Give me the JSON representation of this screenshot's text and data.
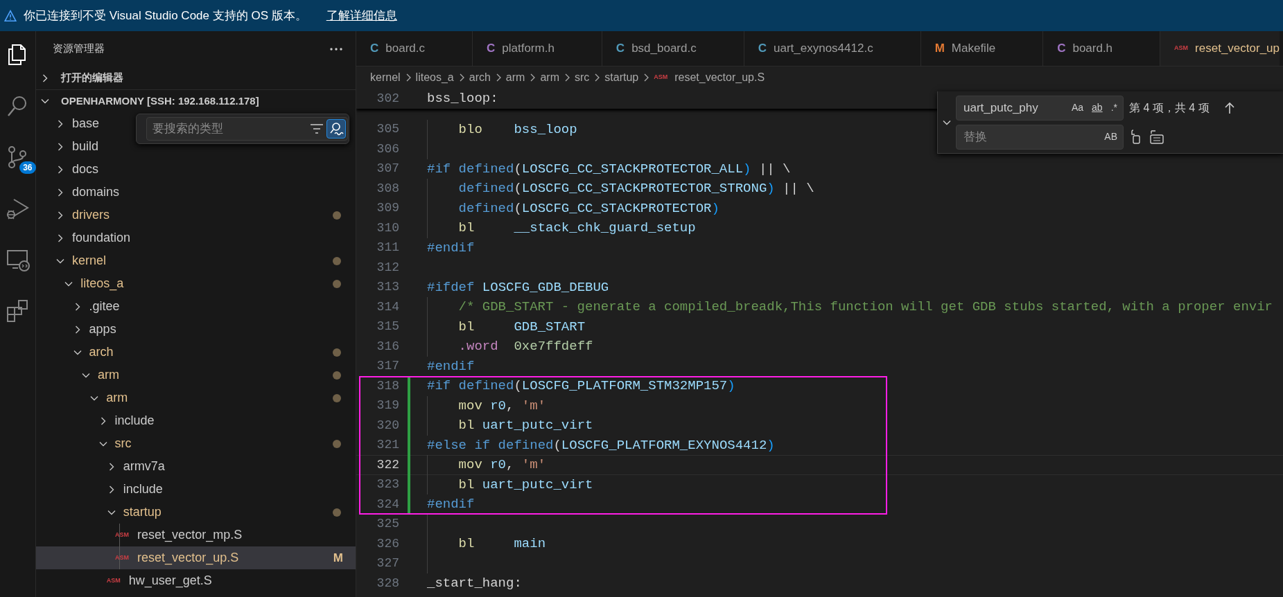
{
  "notification_bar": {
    "message": "你已连接到不受 Visual Studio Code 支持的 OS 版本。",
    "link": "了解详细信息"
  },
  "activity_bar": {
    "items": [
      {
        "kind": "explorer",
        "selected": true
      },
      {
        "kind": "search",
        "selected": false
      },
      {
        "kind": "source-control",
        "selected": false,
        "badge": "36"
      },
      {
        "kind": "run-debug",
        "selected": false
      },
      {
        "kind": "remote",
        "selected": false
      },
      {
        "kind": "extensions",
        "selected": false
      }
    ]
  },
  "sidebar": {
    "title": "资源管理器",
    "sections": [
      {
        "title": "打开的编辑器",
        "expanded": false
      },
      {
        "title": "OPENHARMONY [SSH: 192.168.112.178]",
        "expanded": true
      }
    ],
    "filter": {
      "placeholder": "要搜索的类型",
      "fuzzy_match": true
    },
    "tree": [
      {
        "label": "base",
        "kind": "folder",
        "expanded": false,
        "modified": false
      },
      {
        "label": "build",
        "kind": "folder",
        "expanded": false,
        "modified": false
      },
      {
        "label": "docs",
        "kind": "folder",
        "expanded": false,
        "modified": false
      },
      {
        "label": "domains",
        "kind": "folder",
        "expanded": false,
        "modified": false
      },
      {
        "label": "drivers",
        "kind": "folder",
        "expanded": false,
        "modified": true
      },
      {
        "label": "foundation",
        "kind": "folder",
        "expanded": false,
        "modified": false
      },
      {
        "label": "kernel",
        "kind": "folder",
        "expanded": true,
        "modified": true,
        "children": [
          {
            "label": "liteos_a",
            "kind": "folder",
            "expanded": true,
            "modified": true,
            "children": [
              {
                "label": ".gitee",
                "kind": "folder",
                "expanded": false,
                "modified": false
              },
              {
                "label": "apps",
                "kind": "folder",
                "expanded": false,
                "modified": false
              },
              {
                "label": "arch",
                "kind": "folder",
                "expanded": true,
                "modified": true,
                "children": [
                  {
                    "label": "arm",
                    "kind": "folder",
                    "expanded": true,
                    "modified": true,
                    "children": [
                      {
                        "label": "arm",
                        "kind": "folder",
                        "expanded": true,
                        "modified": true,
                        "children": [
                          {
                            "label": "include",
                            "kind": "folder",
                            "expanded": false,
                            "modified": false
                          },
                          {
                            "label": "src",
                            "kind": "folder",
                            "expanded": true,
                            "modified": true,
                            "children": [
                              {
                                "label": "armv7a",
                                "kind": "folder",
                                "expanded": false,
                                "modified": false
                              },
                              {
                                "label": "include",
                                "kind": "folder",
                                "expanded": false,
                                "modified": false
                              },
                              {
                                "label": "startup",
                                "kind": "folder",
                                "expanded": true,
                                "modified": true,
                                "children": [
                                  {
                                    "label": "reset_vector_mp.S",
                                    "kind": "file",
                                    "icon": "ASM",
                                    "modified": false,
                                    "selected": false
                                  },
                                  {
                                    "label": "reset_vector_up.S",
                                    "kind": "file",
                                    "icon": "ASM",
                                    "modified": true,
                                    "selected": true,
                                    "badge": "M"
                                  }
                                ]
                              },
                              {
                                "label": "hw_user_get.S",
                                "kind": "file",
                                "icon": "ASM",
                                "modified": false,
                                "selected": false
                              }
                            ]
                          }
                        ]
                      }
                    ]
                  }
                ]
              }
            ]
          }
        ]
      }
    ]
  },
  "tabs": [
    {
      "label": "board.c",
      "icon": "C",
      "color": "#519aba",
      "selected": false,
      "modified": false
    },
    {
      "label": "platform.h",
      "icon": "C",
      "color": "#a074c4",
      "selected": false,
      "modified": false
    },
    {
      "label": "bsd_board.c",
      "icon": "C",
      "color": "#519aba",
      "selected": false,
      "modified": false
    },
    {
      "label": "uart_exynos4412.c",
      "icon": "C",
      "color": "#519aba",
      "selected": false,
      "modified": false
    },
    {
      "label": "Makefile",
      "icon": "M",
      "color": "#e37933",
      "selected": false,
      "modified": false
    },
    {
      "label": "board.h",
      "icon": "C",
      "color": "#a074c4",
      "selected": false,
      "modified": false
    },
    {
      "label": "reset_vector_up",
      "icon": "ASM",
      "color": "#cc3e44",
      "selected": true,
      "modified": true
    }
  ],
  "breadcrumb": {
    "items": [
      "kernel",
      "liteos_a",
      "arch",
      "arm",
      "arm",
      "src",
      "startup"
    ],
    "file": {
      "icon": "ASM",
      "label": "reset_vector_up.S"
    }
  },
  "find": {
    "expanded": true,
    "value": "uart_putc_phy",
    "options": [
      {
        "label": "Aa",
        "kind": "case",
        "on": false
      },
      {
        "label": "ab",
        "kind": "word",
        "on": false
      },
      {
        "label": ".*",
        "kind": "regex",
        "on": false
      }
    ],
    "result": "第 4 项，共 4 项",
    "replace_placeholder": "替换",
    "preserve_case": {
      "label": "AB",
      "on": false
    }
  },
  "editor": {
    "sticky": {
      "number": "302",
      "tokens": [
        {
          "text": "bss_loop:",
          "color": "#d4d4d4"
        }
      ]
    },
    "lines": [
      {
        "number": "305",
        "indent": true,
        "tokens": [
          {
            "text": "blo    ",
            "color": "#dcdcaa"
          },
          {
            "text": "bss_loop",
            "color": "#9cdcfe"
          }
        ]
      },
      {
        "number": "306",
        "indent": true
      },
      {
        "number": "307",
        "indent": false,
        "tokens": [
          {
            "text": "#if defined",
            "color": "#569cd6"
          },
          {
            "text": "(",
            "color": "#d4d4d4"
          },
          {
            "text": "LOSCFG_CC_STACKPROTECTOR_ALL",
            "color": "#9cdcfe"
          },
          {
            "text": ")",
            "color": "#179fff"
          },
          {
            "text": " || \\",
            "color": "#d4d4d4"
          }
        ]
      },
      {
        "number": "308",
        "indent": true,
        "tokens": [
          {
            "text": "defined",
            "color": "#569cd6"
          },
          {
            "text": "(",
            "color": "#d4d4d4"
          },
          {
            "text": "LOSCFG_CC_STACKPROTECTOR_STRONG",
            "color": "#9cdcfe"
          },
          {
            "text": ")",
            "color": "#179fff"
          },
          {
            "text": " || \\",
            "color": "#d4d4d4"
          }
        ]
      },
      {
        "number": "309",
        "indent": true,
        "tokens": [
          {
            "text": "defined",
            "color": "#569cd6"
          },
          {
            "text": "(",
            "color": "#d4d4d4"
          },
          {
            "text": "LOSCFG_CC_STACKPROTECTOR",
            "color": "#9cdcfe"
          },
          {
            "text": ")",
            "color": "#179fff"
          }
        ]
      },
      {
        "number": "310",
        "indent": true,
        "tokens": [
          {
            "text": "bl     ",
            "color": "#dcdcaa"
          },
          {
            "text": "__stack_chk_guard_setup",
            "color": "#9cdcfe"
          }
        ]
      },
      {
        "number": "311",
        "indent": false,
        "tokens": [
          {
            "text": "#endif",
            "color": "#569cd6"
          }
        ]
      },
      {
        "number": "312",
        "indent": false
      },
      {
        "number": "313",
        "indent": false,
        "tokens": [
          {
            "text": "#ifdef ",
            "color": "#569cd6"
          },
          {
            "text": "LOSCFG_GDB_DEBUG",
            "color": "#9cdcfe"
          }
        ]
      },
      {
        "number": "314",
        "indent": true,
        "tokens": [
          {
            "text": "/* GDB_START - generate a compiled_breadk,This function will get GDB stubs started, with a proper envir",
            "color": "#6a9955"
          }
        ]
      },
      {
        "number": "315",
        "indent": true,
        "tokens": [
          {
            "text": "bl     ",
            "color": "#dcdcaa"
          },
          {
            "text": "GDB_START",
            "color": "#9cdcfe"
          }
        ]
      },
      {
        "number": "316",
        "indent": true,
        "tokens": [
          {
            "text": ".word  ",
            "color": "#c586c0"
          },
          {
            "text": "0xe7ffdeff",
            "color": "#b5cea8"
          }
        ]
      },
      {
        "number": "317",
        "indent": false,
        "tokens": [
          {
            "text": "#endif",
            "color": "#569cd6"
          }
        ]
      },
      {
        "number": "318",
        "indent": false,
        "added": true,
        "boxed": true,
        "tokens": [
          {
            "text": "#if defined",
            "color": "#569cd6"
          },
          {
            "text": "(",
            "color": "#d4d4d4"
          },
          {
            "text": "LOSCFG_PLATFORM_STM32MP157",
            "color": "#9cdcfe"
          },
          {
            "text": ")",
            "color": "#179fff"
          }
        ]
      },
      {
        "number": "319",
        "indent": true,
        "added": true,
        "boxed": true,
        "tokens": [
          {
            "text": "mov ",
            "color": "#dcdcaa"
          },
          {
            "text": "r0",
            "color": "#9cdcfe"
          },
          {
            "text": ", ",
            "color": "#d4d4d4"
          },
          {
            "text": "'m'",
            "color": "#ce9178"
          }
        ]
      },
      {
        "number": "320",
        "indent": true,
        "added": true,
        "boxed": true,
        "tokens": [
          {
            "text": "bl ",
            "color": "#dcdcaa"
          },
          {
            "text": "uart_putc_virt",
            "color": "#9cdcfe"
          }
        ]
      },
      {
        "number": "321",
        "indent": false,
        "added": true,
        "boxed": true,
        "tokens": [
          {
            "text": "#else if defined",
            "color": "#569cd6"
          },
          {
            "text": "(",
            "color": "#d4d4d4"
          },
          {
            "text": "LOSCFG_PLATFORM_EXYNOS4412",
            "color": "#9cdcfe"
          },
          {
            "text": ")",
            "color": "#179fff"
          }
        ]
      },
      {
        "number": "322",
        "indent": true,
        "added": true,
        "boxed": true,
        "current": true,
        "tokens": [
          {
            "text": "mov ",
            "color": "#dcdcaa"
          },
          {
            "text": "r0",
            "color": "#9cdcfe"
          },
          {
            "text": ", ",
            "color": "#d4d4d4"
          },
          {
            "text": "'m'",
            "color": "#ce9178"
          }
        ]
      },
      {
        "number": "323",
        "indent": true,
        "added": true,
        "boxed": true,
        "tokens": [
          {
            "text": "bl ",
            "color": "#dcdcaa"
          },
          {
            "text": "uart_putc_virt",
            "color": "#9cdcfe"
          }
        ]
      },
      {
        "number": "324",
        "indent": false,
        "added": true,
        "boxed": true,
        "tokens": [
          {
            "text": "#endif",
            "color": "#569cd6"
          }
        ]
      },
      {
        "number": "325",
        "indent": true
      },
      {
        "number": "326",
        "indent": true,
        "tokens": [
          {
            "text": "bl     ",
            "color": "#dcdcaa"
          },
          {
            "text": "main",
            "color": "#9cdcfe"
          }
        ]
      },
      {
        "number": "327",
        "indent": true
      },
      {
        "number": "328",
        "indent": false,
        "tokens": [
          {
            "text": "_start_hang:",
            "color": "#d4d4d4"
          }
        ]
      }
    ]
  }
}
